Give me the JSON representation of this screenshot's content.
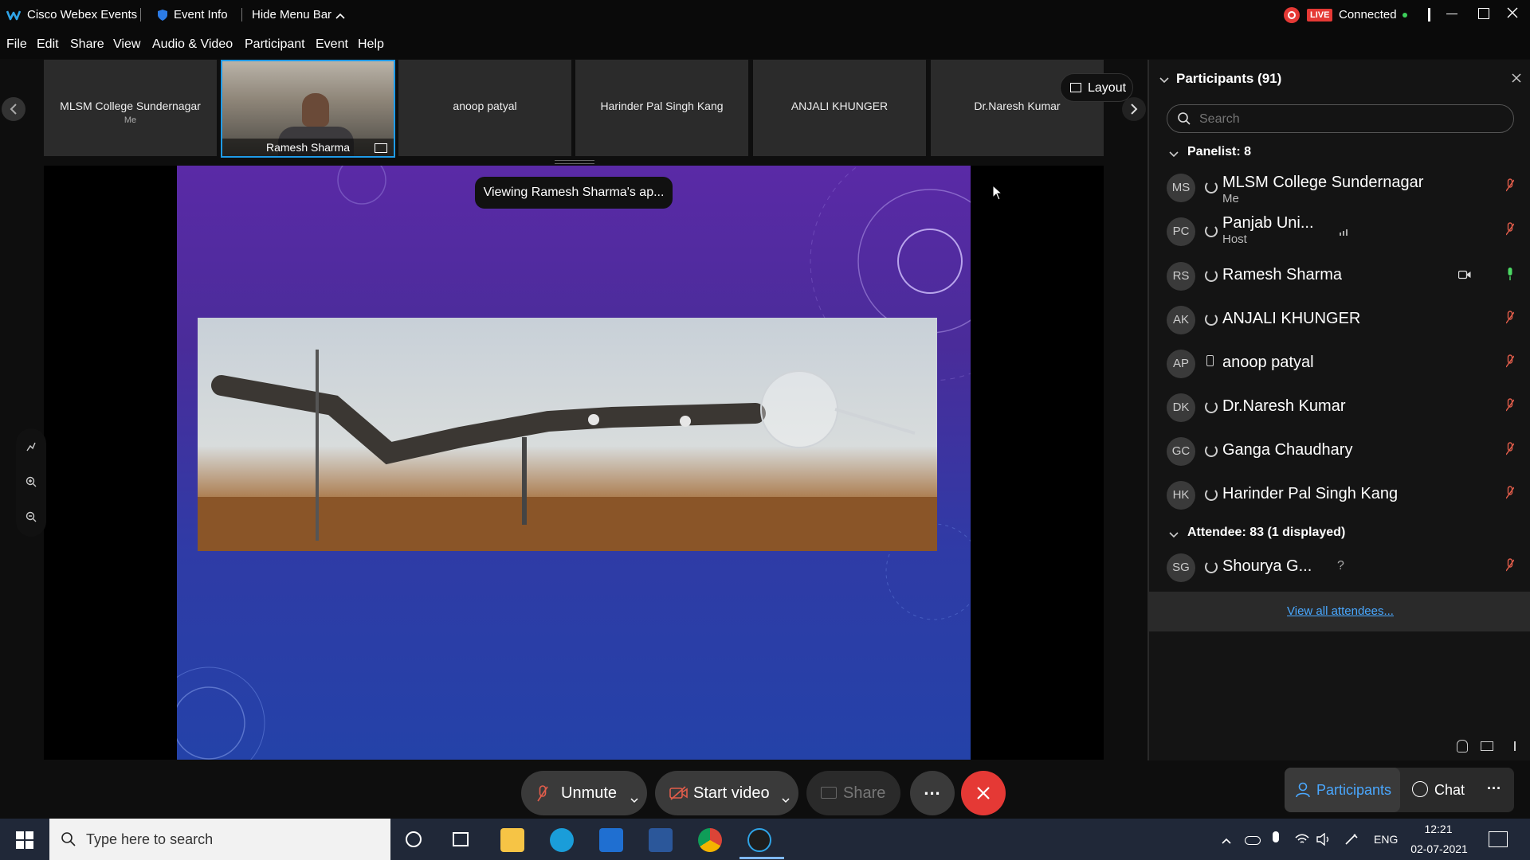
{
  "titlebar": {
    "app_name": "Cisco Webex Events",
    "event_info": "Event Info",
    "hide_menu": "Hide Menu Bar",
    "live_badge": "LIVE",
    "status": "Connected"
  },
  "menu": [
    "File",
    "Edit",
    "Share",
    "View",
    "Audio & Video",
    "Participant",
    "Event",
    "Help"
  ],
  "filmstrip": {
    "tiles": [
      {
        "name": "MLSM College Sundernagar",
        "sub": "Me"
      },
      {
        "name": "Ramesh Sharma",
        "sub": ""
      },
      {
        "name": "anoop patyal",
        "sub": ""
      },
      {
        "name": "Harinder Pal Singh Kang",
        "sub": ""
      },
      {
        "name": "ANJALI KHUNGER",
        "sub": ""
      },
      {
        "name": "Dr.Naresh Kumar",
        "sub": ""
      }
    ],
    "layout_label": "Layout"
  },
  "stage": {
    "viewing_label": "Viewing Ramesh Sharma's ap..."
  },
  "participants": {
    "title": "Participants (91)",
    "search_placeholder": "Search",
    "panelist_header": "Panelist: 8",
    "panelists": [
      {
        "initials": "MS",
        "name": "MLSM College Sundernagar",
        "sub": "Me"
      },
      {
        "initials": "PC",
        "name": "Panjab Uni...",
        "sub": "Host"
      },
      {
        "initials": "RS",
        "name": "Ramesh Sharma",
        "sub": ""
      },
      {
        "initials": "AK",
        "name": "ANJALI KHUNGER",
        "sub": ""
      },
      {
        "initials": "AP",
        "name": "anoop patyal",
        "sub": ""
      },
      {
        "initials": "DK",
        "name": "Dr.Naresh Kumar",
        "sub": ""
      },
      {
        "initials": "GC",
        "name": "Ganga Chaudhary",
        "sub": ""
      },
      {
        "initials": "HK",
        "name": "Harinder Pal Singh Kang",
        "sub": ""
      }
    ],
    "attendee_header": "Attendee: 83 (1 displayed)",
    "attendees": [
      {
        "initials": "SG",
        "name": "Shourya G...",
        "sub": "",
        "extra": "?"
      }
    ],
    "view_all": "View all attendees..."
  },
  "controls": {
    "unmute": "Unmute",
    "start_video": "Start video",
    "share": "Share",
    "more": "...",
    "participants_tab": "Participants",
    "chat_tab": "Chat"
  },
  "taskbar": {
    "search_placeholder": "Type here to search",
    "language": "ENG",
    "time": "12:21",
    "date": "02-07-2021"
  },
  "colors": {
    "live": "#e53935",
    "connected_dot": "#3ccf5a",
    "leave": "#e53935",
    "selected_tile_border": "#1e9be9",
    "link": "#49a8ff",
    "muted_mic": "#e25d4b",
    "active_mic": "#4cd964"
  }
}
